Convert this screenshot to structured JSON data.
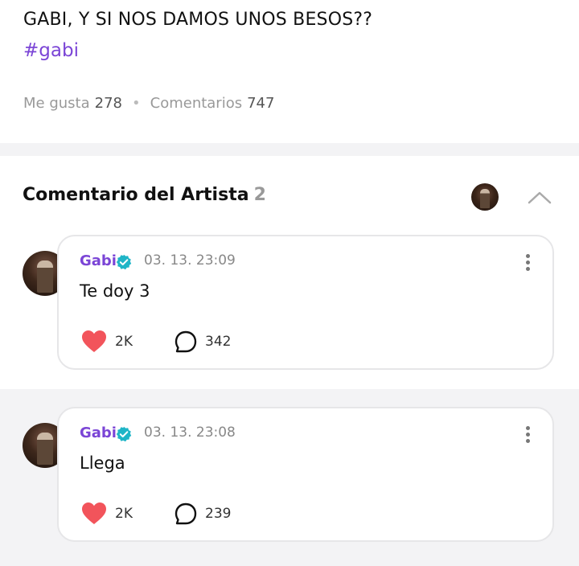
{
  "post": {
    "title": "GABI, Y SI NOS DAMOS UNOS BESOS??",
    "hashtag": "#gabi",
    "likes_label": "Me gusta",
    "likes_count": "278",
    "comments_label": "Comentarios",
    "comments_count": "747"
  },
  "artist_comments": {
    "title": "Comentario del Artista",
    "count": "2",
    "comments": [
      {
        "author": "Gabi",
        "date": "03. 13. 23:09",
        "text": "Te doy 3",
        "likes": "2K",
        "replies": "342"
      },
      {
        "author": "Gabi",
        "date": "03. 13. 23:08",
        "text": "Llega",
        "likes": "2K",
        "replies": "239"
      }
    ]
  },
  "icons": {
    "verified": "verified-badge-icon",
    "like": "heart-icon",
    "reply": "speech-bubble-icon",
    "more": "more-vertical-icon",
    "collapse": "chevron-up-icon"
  },
  "colors": {
    "accent_purple": "#7b45d6",
    "verified_teal": "#1fb5c7",
    "heart_red": "#f2545b",
    "section_gray": "#f3f3f5"
  }
}
